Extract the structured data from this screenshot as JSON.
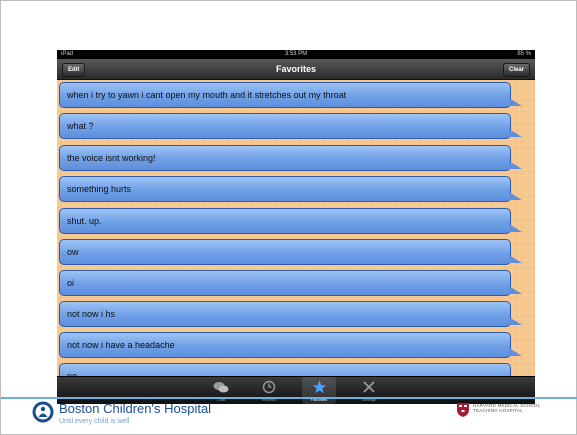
{
  "status": {
    "device": "iPad",
    "time": "3:53 PM",
    "battery": "85 %"
  },
  "navbar": {
    "title": "Favorites",
    "edit_label": "Edit",
    "clear_label": "Clear"
  },
  "favorites": [
    "when i try to yawn i cant open my mouth and it stretches out my throat",
    "what ?",
    "the voice isnt working!",
    "something hurts",
    "shut. up.",
    "ow",
    "oi",
    "not now i hs",
    "not now i have  a headache",
    "no"
  ],
  "tabs": [
    {
      "label": "Chat",
      "icon": "chat-bubbles-icon"
    },
    {
      "label": "Recents",
      "icon": "clock-icon"
    },
    {
      "label": "Favorites",
      "icon": "star-icon"
    },
    {
      "label": "Settings",
      "icon": "tools-icon"
    }
  ],
  "footer": {
    "hospital_name": "Boston Children's Hospital",
    "tagline": "Until every child is well",
    "hms_line1": "HARVARD MEDICAL SCHOOL",
    "hms_line2": "TEACHING HOSPITAL"
  },
  "colors": {
    "bubble": "#6fa0e6",
    "background": "#f4c58d",
    "accent_rule": "#6bb0e2",
    "brand": "#1a4f8f"
  }
}
